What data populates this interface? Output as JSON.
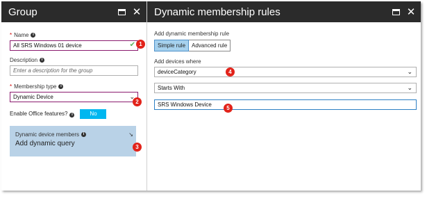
{
  "left_blade": {
    "title": "Group",
    "name_label": "Name",
    "name_value": "All SRS Windows 01 device",
    "description_label": "Description",
    "description_placeholder": "Enter a description for the group",
    "membership_label": "Membership type",
    "membership_value": "Dynamic Device",
    "office_label": "Enable Office features?",
    "office_value": "No",
    "dynamic_members_label": "Dynamic device members",
    "dynamic_query_label": "Add dynamic query"
  },
  "right_blade": {
    "title": "Dynamic membership rules",
    "add_rule_label": "Add dynamic membership rule",
    "simple_rule": "Simple rule",
    "advanced_rule": "Advanced rule",
    "add_devices_label": "Add devices where",
    "property_value": "deviceCategory",
    "operator_value": "Starts With",
    "value_input": "SRS Windows Device"
  },
  "markers": [
    "1",
    "2",
    "3",
    "4",
    "5"
  ],
  "colors": {
    "header_bg": "#2b2b2b",
    "toggle_blue": "#00b7f0",
    "dyn_box": "#b9d2e7",
    "marker_red": "#e2231a",
    "selected_seg": "#a6d1ee"
  }
}
